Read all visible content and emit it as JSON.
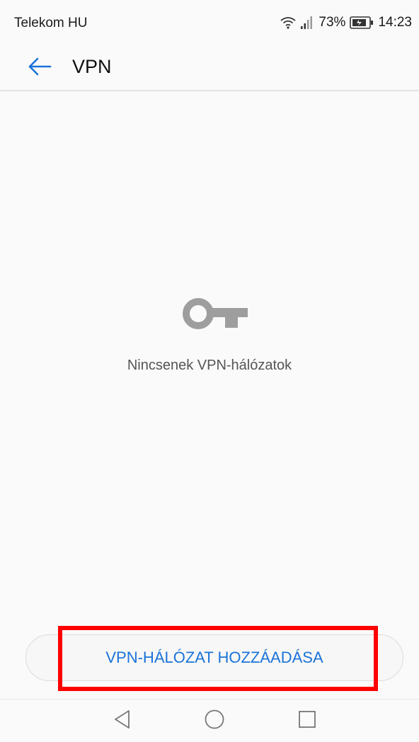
{
  "status_bar": {
    "carrier": "Telekom HU",
    "battery": "73%",
    "time": "14:23",
    "icons": [
      "wifi-icon",
      "signal-icon",
      "battery-charging-icon"
    ]
  },
  "app_bar": {
    "back_icon": "arrow-left-icon",
    "title": "VPN",
    "accent_color": "#1a73d9"
  },
  "empty_state": {
    "icon": "key-icon",
    "message": "Nincsenek VPN-hálózatok"
  },
  "actions": {
    "add_vpn_label": "VPN-HÁLÓZAT HOZZÁADÁSA"
  },
  "annotation": {
    "highlight_color": "#ff0000"
  },
  "nav_bar": {
    "buttons": [
      "back-triangle-icon",
      "home-circle-icon",
      "recents-square-icon"
    ]
  }
}
